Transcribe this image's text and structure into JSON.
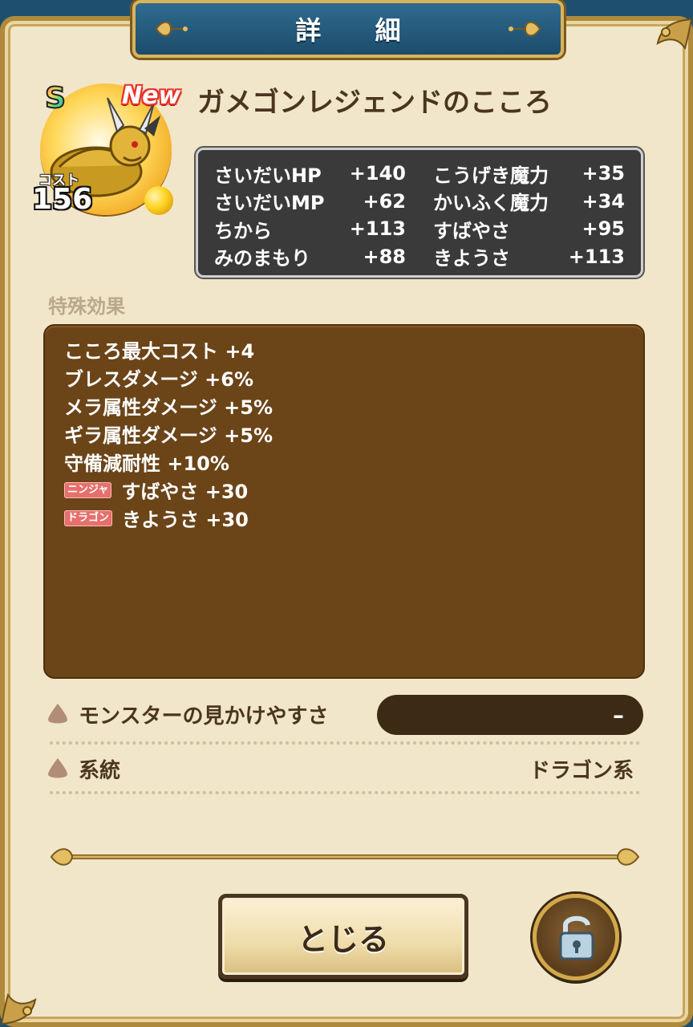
{
  "dialog": {
    "title": "詳 細"
  },
  "item": {
    "rank": "S",
    "new_badge": "New",
    "name": "ガメゴンレジェンドのこころ",
    "cost_label": "コスト",
    "cost_value": "156"
  },
  "stats": [
    {
      "label": "さいだいHP",
      "value": "+140"
    },
    {
      "label": "こうげき魔力",
      "value": "+35"
    },
    {
      "label": "さいだいMP",
      "value": "+62"
    },
    {
      "label": "かいふく魔力",
      "value": "+34"
    },
    {
      "label": "ちから",
      "value": "+113"
    },
    {
      "label": "すばやさ",
      "value": "+95"
    },
    {
      "label": "みのまもり",
      "value": "+88"
    },
    {
      "label": "きようさ",
      "value": "+113"
    }
  ],
  "special": {
    "label": "特殊効果",
    "effects": [
      {
        "text": "こころ最大コスト +4"
      },
      {
        "text": "ブレスダメージ +6%"
      },
      {
        "text": "メラ属性ダメージ +5%"
      },
      {
        "text": "ギラ属性ダメージ +5%"
      },
      {
        "text": "守備減耐性 +10%"
      },
      {
        "tag": "ニンジャ",
        "text": "すばやさ +30"
      },
      {
        "tag": "ドラゴン",
        "text": "きようさ +30"
      }
    ]
  },
  "info": {
    "visibility_label": "モンスターの見かけやすさ",
    "visibility_value": "–",
    "family_label": "系統",
    "family_value": "ドラゴン系"
  },
  "buttons": {
    "close_label": "とじる"
  },
  "icons": {
    "lock": "unlocked-padlock-icon",
    "drop": "drop-icon",
    "fleur": "fleur-de-lis-icon"
  },
  "colors": {
    "accent_gold": "#d9b35a",
    "title_blue": "#1c4c6b",
    "panel_brown": "#6b4418",
    "parchment": "#f1e6c9",
    "tag_red": "#e5706c"
  }
}
